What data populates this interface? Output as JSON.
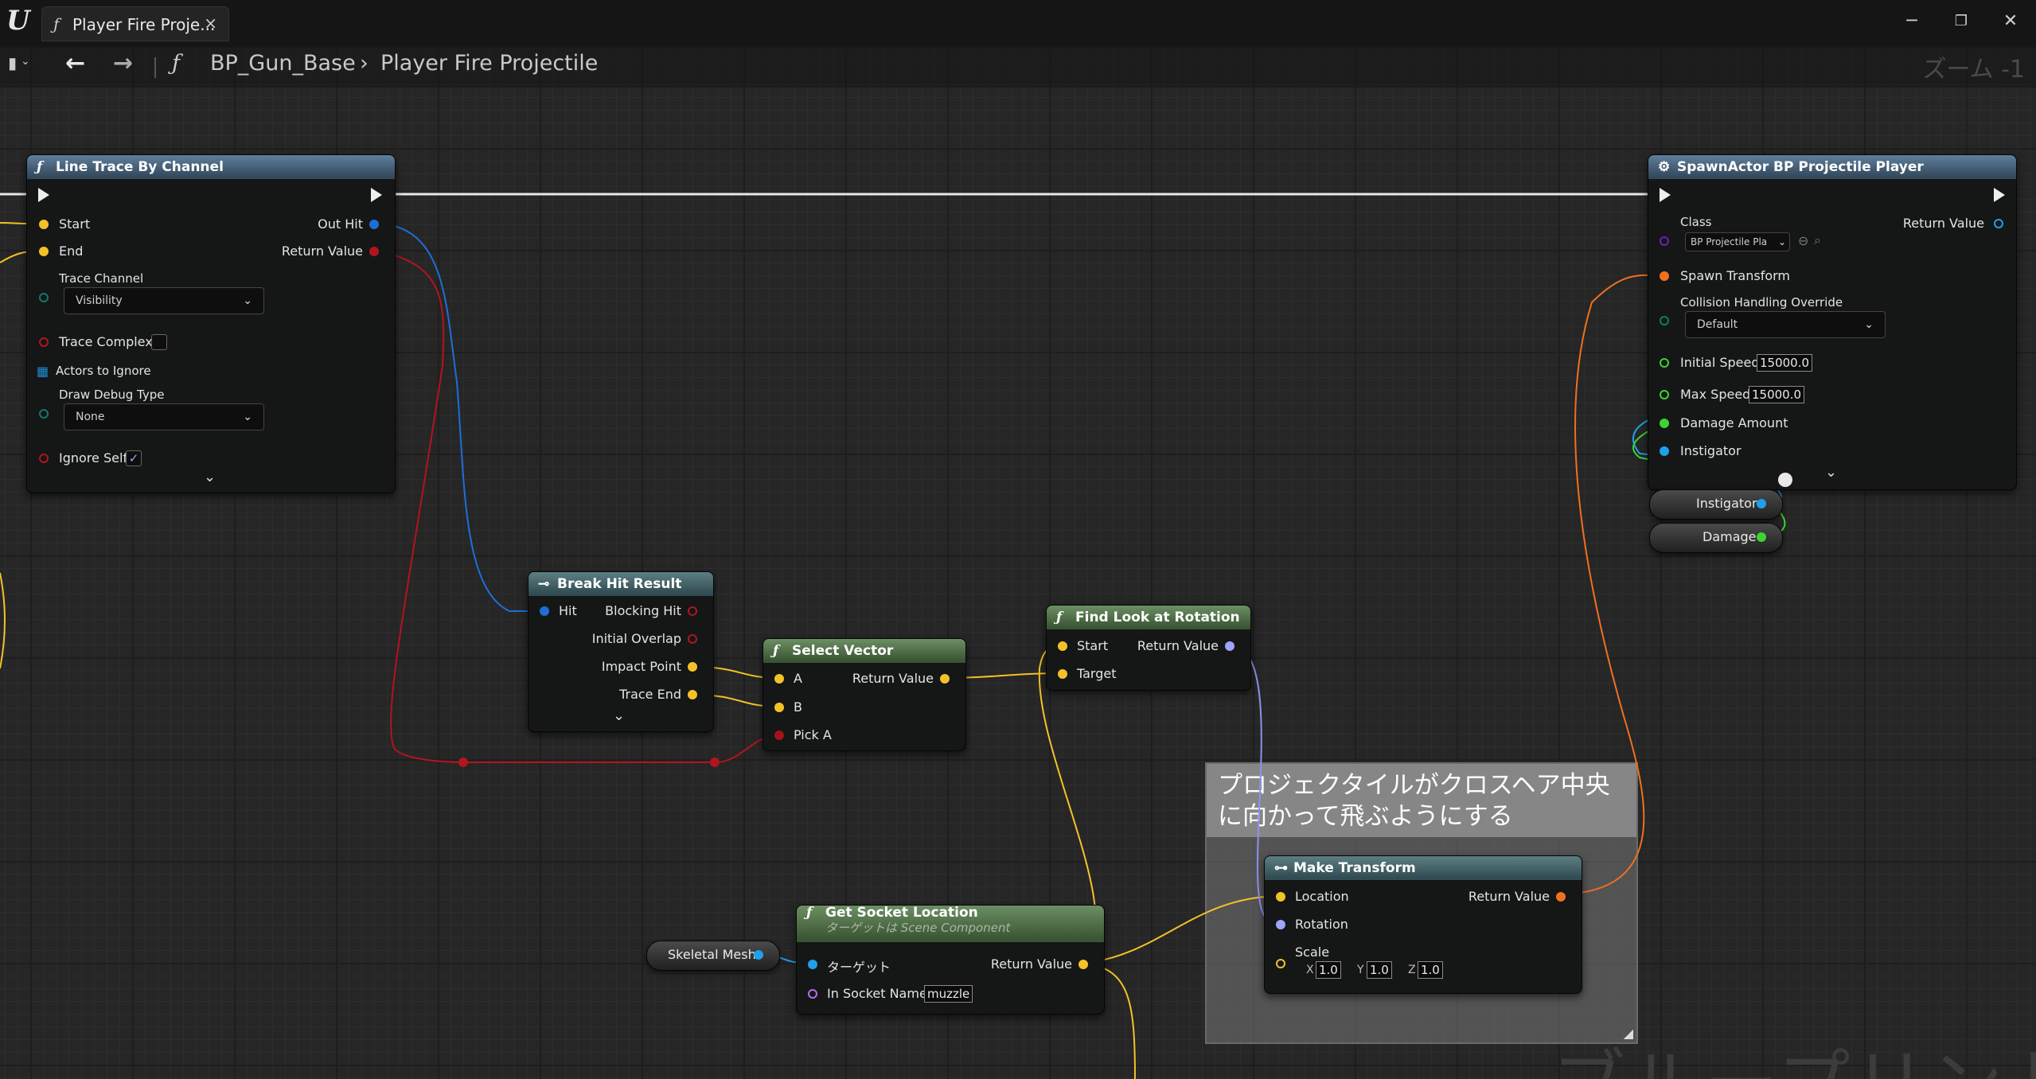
{
  "window": {
    "tab_title": "Player Fire Proje...",
    "tab_close": "×",
    "tab_icon": "function-icon",
    "controls": {
      "minimize": "─",
      "restore": "❐",
      "close": "✕"
    }
  },
  "toolbar": {
    "bookmark_icon": "▮",
    "back": "←",
    "forward": "→",
    "function_glyph": "ƒ",
    "breadcrumb_root": "BP_Gun_Base",
    "breadcrumb_sep": "›",
    "breadcrumb_current": "Player Fire Projectile",
    "zoom": "ズーム -1"
  },
  "watermark": "ブループリント",
  "nodes": {
    "line_trace": {
      "title": "Line Trace By Channel",
      "pins": {
        "start": "Start",
        "end": "End",
        "out_hit": "Out Hit",
        "return_value": "Return Value",
        "trace_channel": "Trace Channel",
        "trace_channel_value": "Visibility",
        "trace_complex": "Trace Complex",
        "actors_to_ignore": "Actors to Ignore",
        "draw_debug_type": "Draw Debug Type",
        "draw_debug_value": "None",
        "ignore_self": "Ignore Self"
      },
      "trace_complex_checked": false,
      "ignore_self_checked": true
    },
    "break_hit": {
      "title": "Break Hit Result",
      "pins": {
        "hit": "Hit",
        "blocking_hit": "Blocking Hit",
        "initial_overlap": "Initial Overlap",
        "impact_point": "Impact Point",
        "trace_end": "Trace End"
      }
    },
    "select_vector": {
      "title": "Select Vector",
      "pins": {
        "a": "A",
        "b": "B",
        "pick_a": "Pick A",
        "return_value": "Return Value"
      }
    },
    "find_look": {
      "title": "Find Look at Rotation",
      "pins": {
        "start": "Start",
        "target": "Target",
        "return_value": "Return Value"
      }
    },
    "get_socket": {
      "title": "Get Socket Location",
      "subtitle": "ターゲットは Scene Component",
      "pins": {
        "target": "ターゲット",
        "in_socket_name": "In Socket Name",
        "socket_value": "muzzle",
        "return_value": "Return Value"
      }
    },
    "skeletal_mesh": {
      "label": "Skeletal Mesh"
    },
    "make_transform": {
      "title": "Make Transform",
      "pins": {
        "location": "Location",
        "rotation": "Rotation",
        "scale": "Scale",
        "return_value": "Return Value"
      },
      "scale": {
        "x_label": "X",
        "x": "1.0",
        "y_label": "Y",
        "y": "1.0",
        "z_label": "Z",
        "z": "1.0"
      }
    },
    "spawn_actor": {
      "title": "SpawnActor BP Projectile Player",
      "pins": {
        "class": "Class",
        "class_value": "BP Projectile Pla",
        "return_value": "Return Value",
        "spawn_transform": "Spawn Transform",
        "collision": "Collision Handling Override",
        "collision_value": "Default",
        "initial_speed": "Initial Speed",
        "initial_speed_value": "15000.0",
        "max_speed": "Max Speed",
        "max_speed_value": "15000.0",
        "damage_amount": "Damage Amount",
        "instigator": "Instigator"
      }
    },
    "instigator_var": {
      "label": "Instigator"
    },
    "damage_var": {
      "label": "Damage"
    }
  },
  "comment": {
    "text_line1": "プロジェクタイルがクロスヘア中央",
    "text_line2": "に向かって飛ぶようにする"
  },
  "colors": {
    "vector_pin": "#f4c228",
    "struct_pin": "#0f6fe0",
    "bool_pin": "#a4121d",
    "object_pin": "#1fa0e8",
    "float_pin": "#3cd431",
    "rotator_pin": "#9ea4ff",
    "transform_pin": "#f07020",
    "byte_pin": "#10796f",
    "class_pin": "#6a22b5",
    "name_pin": "#b46cf0"
  }
}
